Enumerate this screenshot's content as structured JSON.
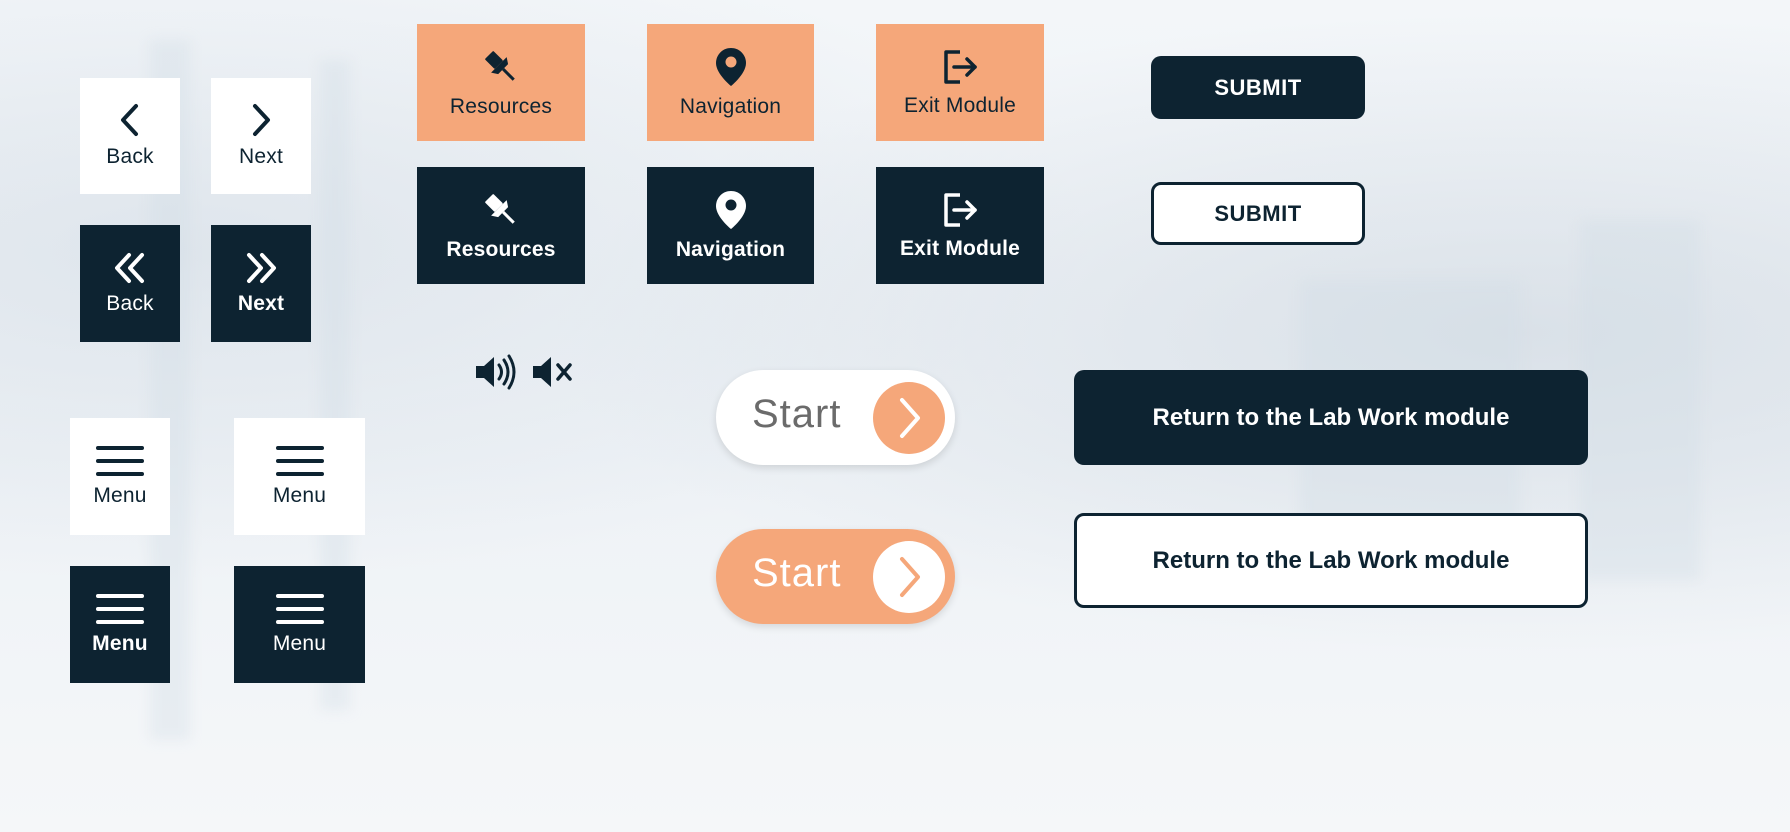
{
  "nav_small": {
    "back_label": "Back",
    "next_label": "Next",
    "back_dark_label": "Back",
    "next_dark_label": "Next"
  },
  "module_buttons": {
    "orange": {
      "resources_label": "Resources",
      "navigation_label": "Navigation",
      "exit_label": "Exit Module"
    },
    "dark": {
      "resources_label": "Resources",
      "navigation_label": "Navigation",
      "exit_label": "Exit Module"
    }
  },
  "menu_buttons": {
    "light_1": "Menu",
    "light_2": "Menu",
    "dark_bold": "Menu",
    "dark_regular": "Menu"
  },
  "audio": {
    "on_icon": "speaker-on-icon",
    "mute_icon": "speaker-mute-icon"
  },
  "start_buttons": {
    "white_label": "Start",
    "orange_label": "Start"
  },
  "submit_buttons": {
    "dark_label": "SUBMIT",
    "light_label": "SUBMIT"
  },
  "return_buttons": {
    "dark_label": "Return to the Lab Work module",
    "light_label": "Return to the Lab Work module"
  },
  "colors": {
    "navy": "#0d2331",
    "orange": "#f5a77a",
    "white": "#ffffff"
  }
}
